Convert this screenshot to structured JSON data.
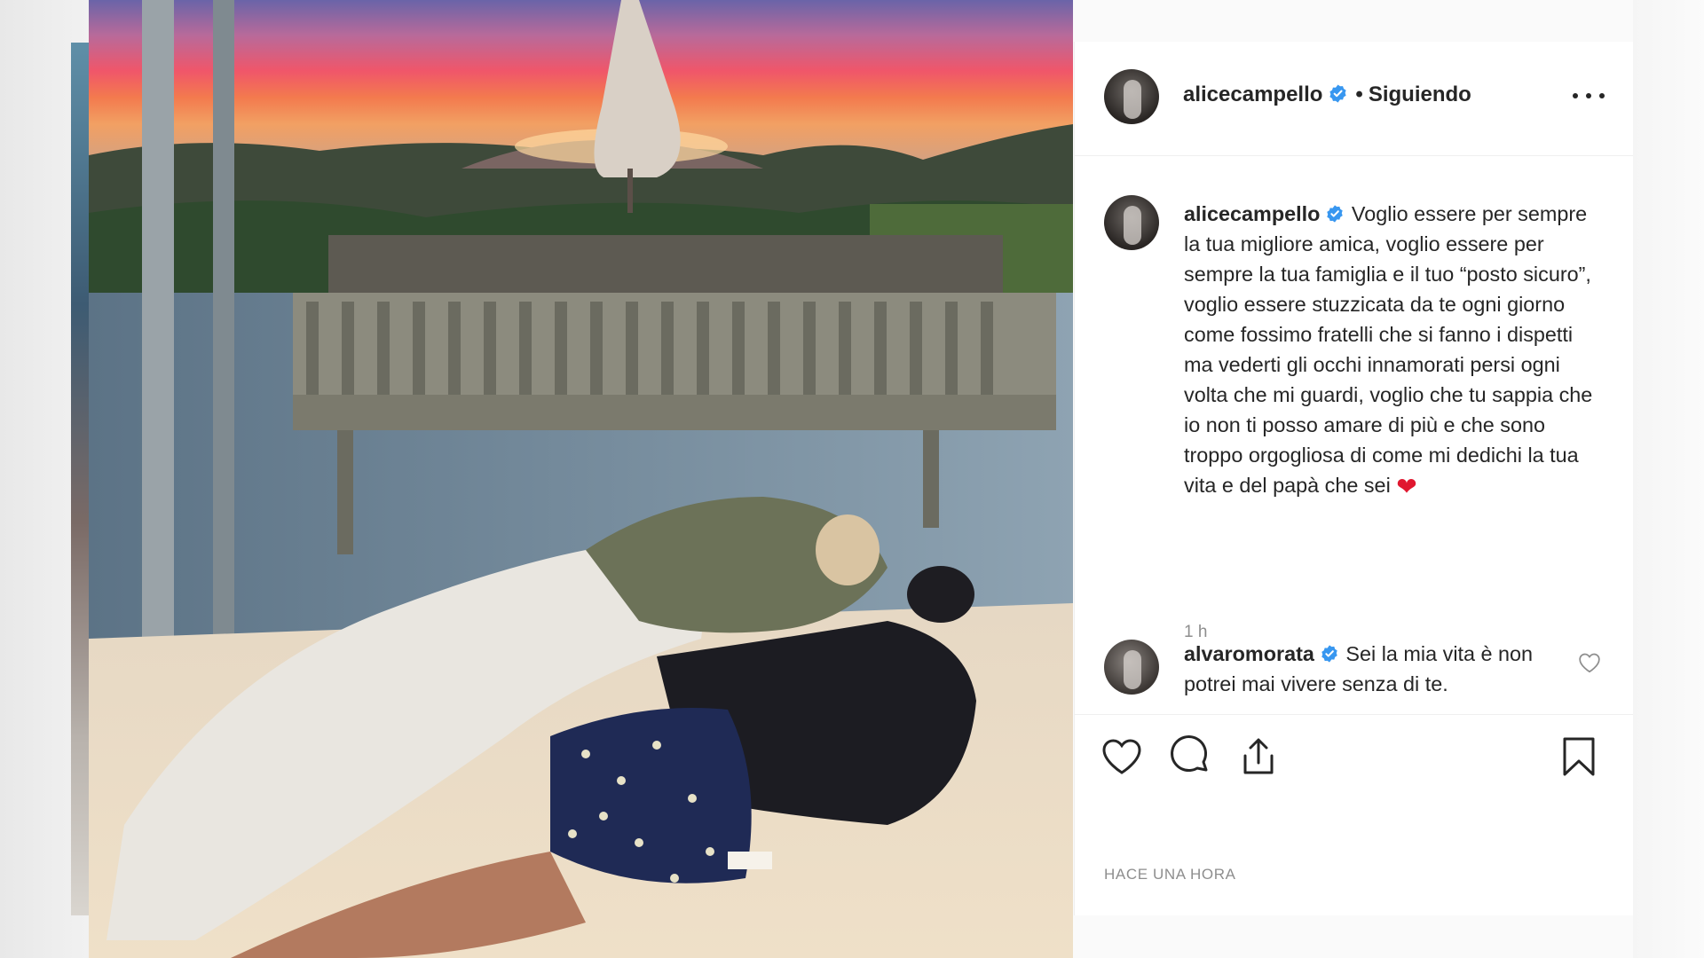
{
  "post": {
    "username": "alicecampello",
    "follow_separator": "•",
    "follow_status": "Siguiendo",
    "more_icon": "more-options-icon",
    "caption": "Voglio essere per sempre la tua migliore amica, voglio essere per sempre la tua famiglia e il tuo “posto sicuro”, voglio essere stuzzicata da te ogni giorno come fossimo fratelli che si fanno i dispetti ma vederti gli occhi innamorati persi ogni volta che mi guardi, voglio che tu sappia che io non ti posso amare di più e che sono troppo orgogliosa di come mi dedichi la tua vita e del papà che sei",
    "caption_emoji": "❤",
    "caption_time": "1 h",
    "comments": [
      {
        "username": "alvaromorata",
        "text": "Sei la mia vita è non potrei mai vivere senza di te."
      }
    ],
    "timestamp": "HACE UNA HORA"
  },
  "colors": {
    "verified": "#3897f0",
    "text": "#262626",
    "muted": "#8e8e8e",
    "border": "#efefef",
    "heart_emoji": "#e0172f"
  }
}
